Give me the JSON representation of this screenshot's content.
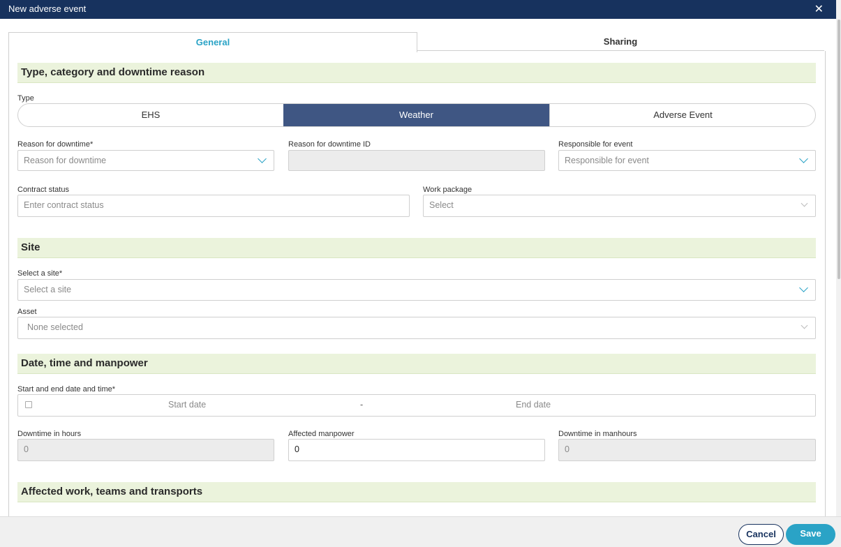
{
  "dialog": {
    "title": "New adverse event"
  },
  "tabs": [
    {
      "label": "General"
    },
    {
      "label": "Sharing"
    }
  ],
  "sections": {
    "type": "Type, category and downtime reason",
    "site": "Site",
    "datetime": "Date, time and manpower",
    "affected": "Affected work, teams and transports"
  },
  "type_field": {
    "label": "Type",
    "options": [
      "EHS",
      "Weather",
      "Adverse Event"
    ],
    "selected": "Weather"
  },
  "reason": {
    "label": "Reason for downtime*",
    "placeholder": "Reason for downtime"
  },
  "reason_id": {
    "label": "Reason for downtime ID",
    "value": ""
  },
  "responsible": {
    "label": "Responsible for event",
    "placeholder": "Responsible for event"
  },
  "contract_status": {
    "label": "Contract status",
    "placeholder": "Enter contract status"
  },
  "work_package": {
    "label": "Work package",
    "placeholder": "Select"
  },
  "site_select": {
    "label": "Select a site*",
    "placeholder": "Select a site"
  },
  "asset": {
    "label": "Asset",
    "placeholder": "None selected"
  },
  "date_range": {
    "label": "Start and end date and time*",
    "start_placeholder": "Start date",
    "separator": "-",
    "end_placeholder": "End date"
  },
  "downtime_hours": {
    "label": "Downtime in hours",
    "value": "0"
  },
  "affected_manpower": {
    "label": "Affected manpower",
    "value": "0"
  },
  "downtime_manhours": {
    "label": "Downtime in manhours",
    "value": "0"
  },
  "footer": {
    "cancel_label": "Cancel",
    "save_label": "Save"
  },
  "colors": {
    "header": "#17325e",
    "accent": "#2aa3c6",
    "section_bg": "#ebf3dc",
    "segment_active": "#3f5683"
  }
}
